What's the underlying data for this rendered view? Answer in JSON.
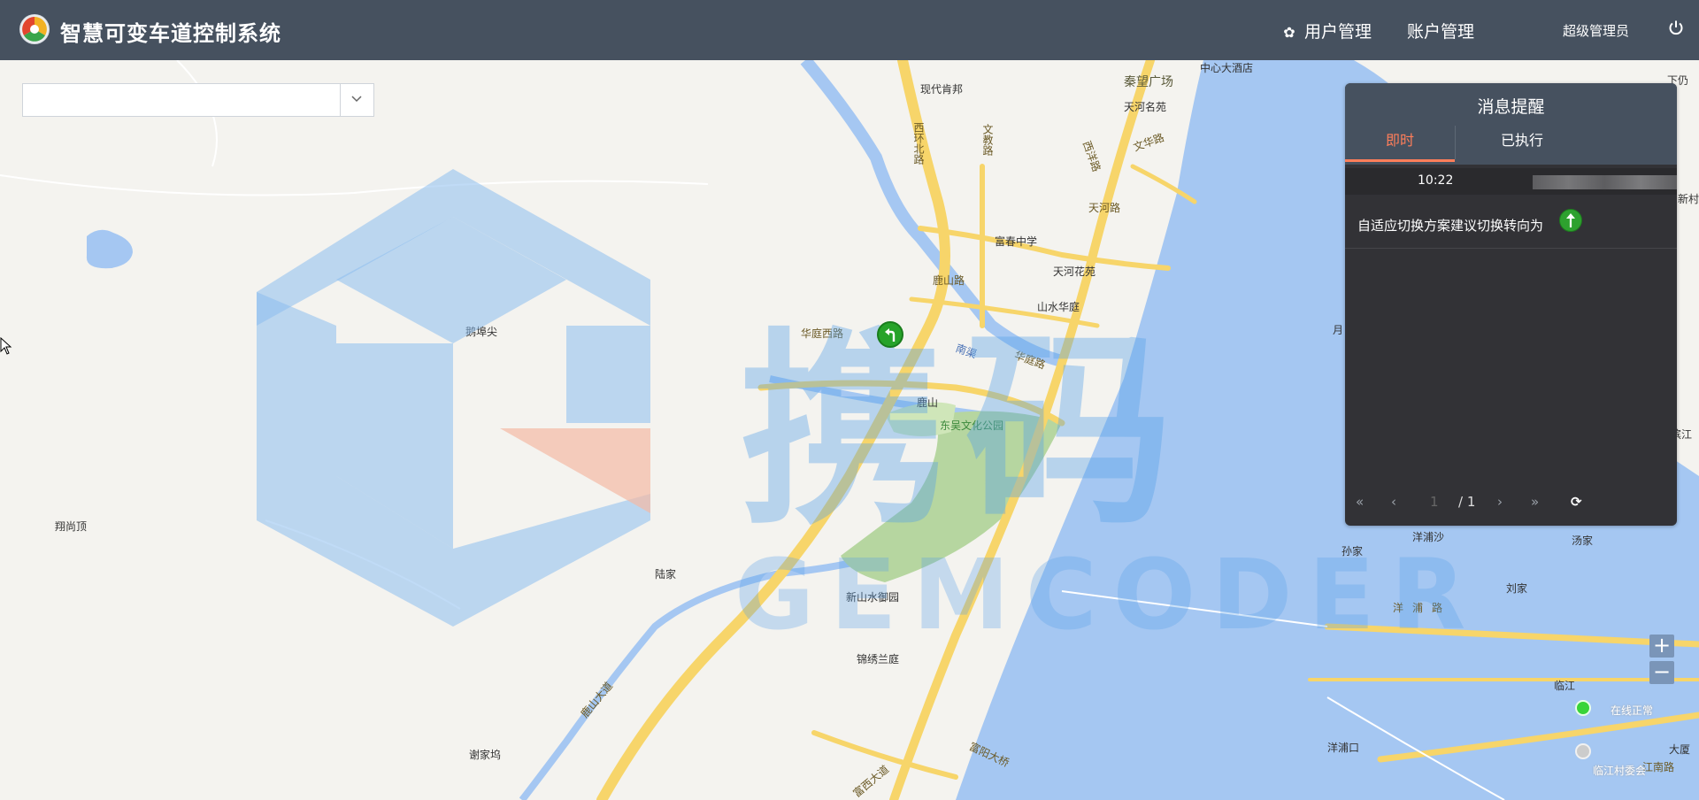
{
  "header": {
    "app_title": "智慧可变车道控制系统",
    "nav_users": "用户管理",
    "nav_accounts": "账户管理",
    "admin": "超级管理员"
  },
  "region_select": {
    "value": ""
  },
  "map_labels": {
    "zhongxin_hotel": "中心大酒店",
    "qinwang_plaza": "秦望广场",
    "xiandai_kenbang": "现代肯邦",
    "tianhe_mingyuan": "天河名苑",
    "wenhua_rd": "文华路",
    "wenjiao_rd": "文教路",
    "xihuan_bei_rd": "西环北路",
    "xiyang_rd": "西洋路",
    "tianhe_rd": "天河路",
    "fuchun_school": "富春中学",
    "lushan_rd_top": "鹿山路",
    "tianhe_huayuan": "天河花苑",
    "shanshui_huating": "山水华庭",
    "nan_canal": "南渠",
    "huating_xi_rd": "华庭西路",
    "huating_rd": "华庭路",
    "lushan": "鹿山",
    "dongwu_park": "东吴文化公园",
    "ejiajian": "鹅埠尖",
    "yueshangding": "翔尚顶",
    "lujia": "陆家",
    "xinshan_shuiyu": "新山水御园",
    "jinxiu_lanting": "锦绣兰庭",
    "lushan_dadao": "鹿山大道",
    "xiejiawu": "谢家坞",
    "fuyang_bridge": "富阳大桥",
    "fuxi_dadao": "富西大道",
    "yangpusha": "洋浦沙",
    "sunjia": "孙家",
    "tangjia": "汤家",
    "liujia": "刘家",
    "yangpu_rd": "洋浦路",
    "linjiang": "临江",
    "yangpukou": "洋浦口",
    "xiaxing": "下仍",
    "xinlu": "新村",
    "jiang": "滨江",
    "dalou": "大厦",
    "jiangnan_rd": "江南路",
    "yue": "月"
  },
  "watermark": {
    "cn": "携码",
    "en": "GEMCODER"
  },
  "message_panel": {
    "title": "消息提醒",
    "tabs": [
      "即时",
      "已执行"
    ],
    "time": "10:22",
    "text": "自适应切换方案建议切换转向为",
    "pager": {
      "first": "«",
      "prev": "‹",
      "current": "1",
      "total": "/ 1",
      "next": "›",
      "last": "»",
      "refresh": "⟳"
    }
  },
  "zoom": {
    "in": "+",
    "out": "−"
  },
  "status_labels": {
    "online": "在线正常",
    "offline": "临江村委会"
  },
  "colors": {
    "header": "#46515f",
    "accent_tab": "#ff7e5a",
    "marker_green": "#27a32a",
    "river": "#a5c7f2",
    "road_main": "#f8d872"
  }
}
